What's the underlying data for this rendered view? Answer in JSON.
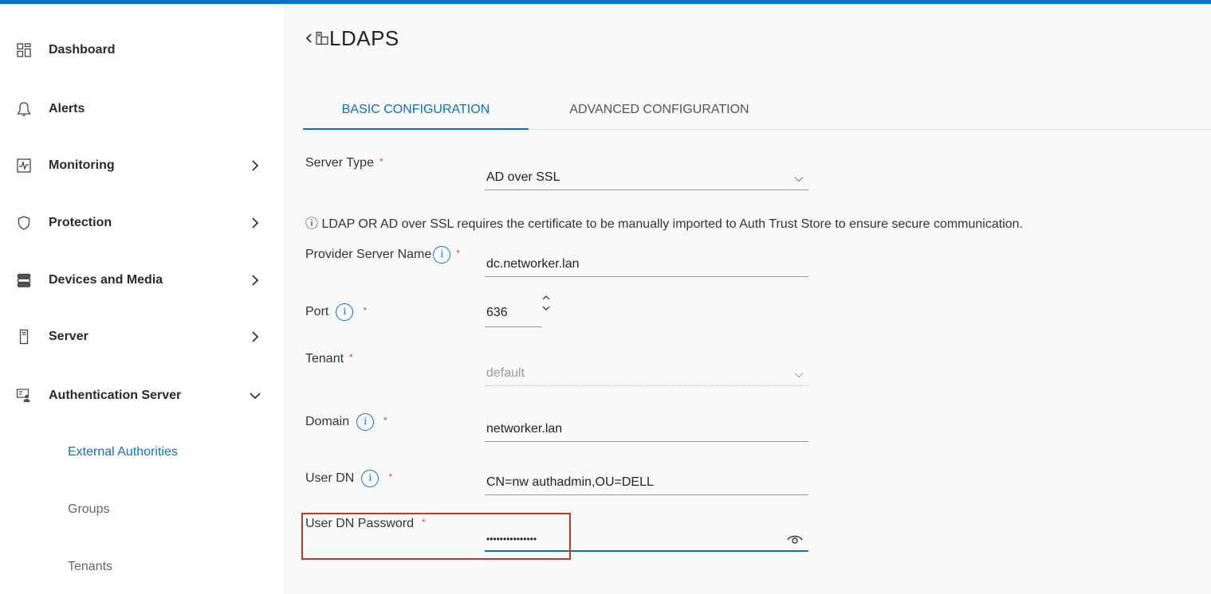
{
  "sidebar": {
    "items": [
      {
        "label": "Dashboard",
        "icon": "dashboard-icon",
        "has_chevron": false
      },
      {
        "label": "Alerts",
        "icon": "bell-icon",
        "has_chevron": false
      },
      {
        "label": "Monitoring",
        "icon": "monitoring-icon",
        "has_chevron": true
      },
      {
        "label": "Protection",
        "icon": "shield-icon",
        "has_chevron": true
      },
      {
        "label": "Devices and Media",
        "icon": "storage-icon",
        "has_chevron": true
      },
      {
        "label": "Server",
        "icon": "server-icon",
        "has_chevron": true
      },
      {
        "label": "Authentication Server",
        "icon": "auth-server-icon",
        "has_chevron": true,
        "expanded": true
      }
    ],
    "sub_items": [
      {
        "label": "External Authorities",
        "active": true
      },
      {
        "label": "Groups",
        "active": false
      },
      {
        "label": "Tenants",
        "active": false
      }
    ]
  },
  "header": {
    "title": "LDAPS",
    "back_icon": "chevron-left-icon",
    "title_icon": "server-icon"
  },
  "tabs": [
    {
      "label": "BASIC CONFIGURATION",
      "active": true
    },
    {
      "label": "ADVANCED CONFIGURATION",
      "active": false
    }
  ],
  "form": {
    "server_type": {
      "label": "Server Type",
      "value": "AD over SSL"
    },
    "notice": "ⓘ LDAP OR AD over SSL requires the certificate to be manually imported to Auth Trust Store to ensure secure communication.",
    "provider_server_name": {
      "label": "Provider Server Name",
      "value": "dc.networker.lan"
    },
    "port": {
      "label": "Port",
      "value": "636"
    },
    "tenant": {
      "label": "Tenant",
      "value": "default"
    },
    "domain": {
      "label": "Domain",
      "value": "networker.lan"
    },
    "user_dn": {
      "label": "User DN",
      "value": "CN=nw authadmin,OU=DELL"
    },
    "user_dn_password": {
      "label": "User DN Password",
      "value": "•••••••••••••••"
    },
    "required_mark": "*",
    "info_glyph": "i"
  },
  "colors": {
    "accent": "#0672cb",
    "required": "#d14b4b",
    "highlight": "#c0392b",
    "main_bg": "#f9f9f9"
  }
}
